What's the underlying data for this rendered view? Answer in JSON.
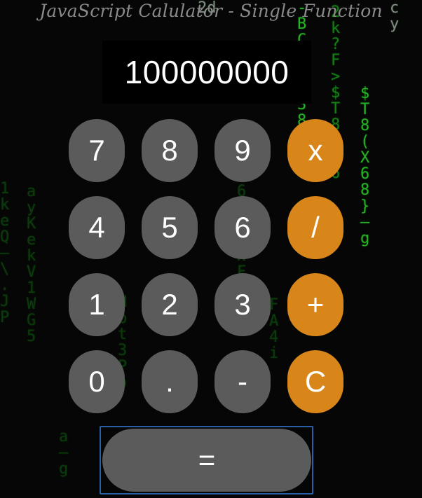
{
  "app": {
    "title": "JavaScript Calulator - Single Function"
  },
  "display": {
    "value": "100000000"
  },
  "keys": {
    "k7": "7",
    "k8": "8",
    "k9": "9",
    "multiply": "x",
    "k4": "4",
    "k5": "5",
    "k6": "6",
    "divide": "/",
    "k1": "1",
    "k2": "2",
    "k3": "3",
    "add": "+",
    "k0": "0",
    "decimal": ".",
    "subtract": "-",
    "clear": "C",
    "equals": "="
  },
  "colors": {
    "number_key": "#5b5b5b",
    "operator_key": "#d8861a",
    "display_bg": "#000000",
    "focus_outline": "#2a5fa8",
    "matrix_green": "#1aa51a"
  }
}
